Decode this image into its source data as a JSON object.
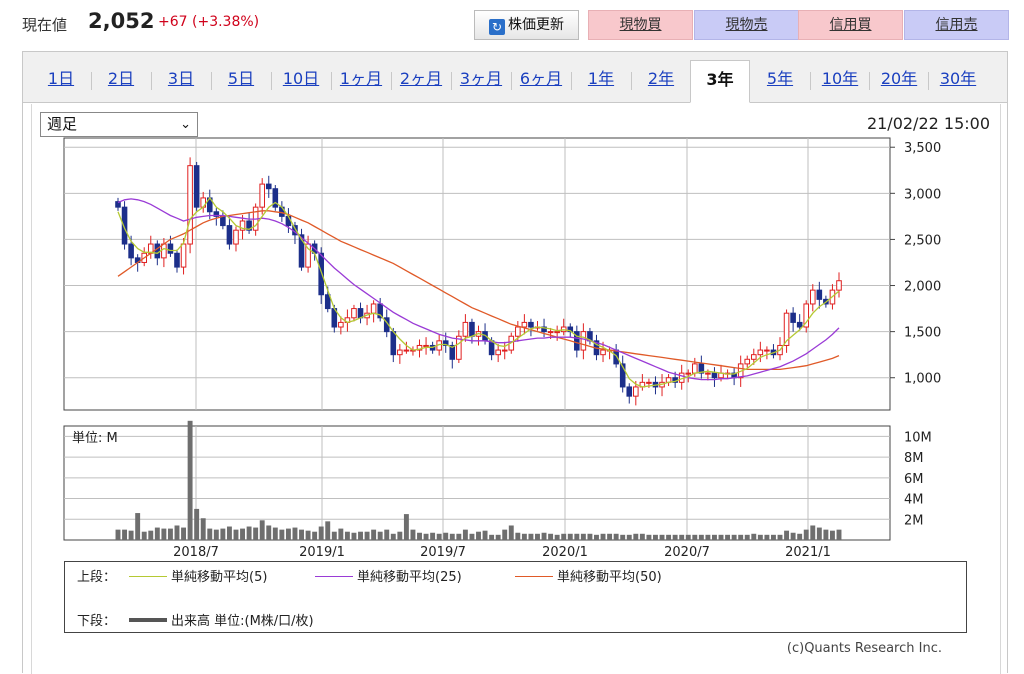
{
  "header": {
    "price_label": "現在値",
    "price_value": "2,052",
    "price_change": "+67 (+3.38%)",
    "refresh_label": "株価更新",
    "buttons": [
      "現物買",
      "現物売",
      "信用買",
      "信用売"
    ]
  },
  "tabs": [
    "1日",
    "2日",
    "3日",
    "5日",
    "10日",
    "1ヶ月",
    "2ヶ月",
    "3ヶ月",
    "6ヶ月",
    "1年",
    "2年",
    "3年",
    "5年",
    "10年",
    "20年",
    "30年"
  ],
  "active_tab": "3年",
  "period_select": "週足",
  "datetime": "21/02/22 15:00",
  "legend": {
    "upper_label": "上段：",
    "lower_label": "下段：",
    "ma5": "単純移動平均(5)",
    "ma25": "単純移動平均(25)",
    "ma50": "単純移動平均(50)",
    "volume": "出来高 単位:(M株/口/枚)"
  },
  "colors": {
    "up": "#e02020",
    "down": "#1c2f8a",
    "ma5": "#b5c933",
    "ma25": "#9a3bd6",
    "ma50": "#e05a28",
    "volume": "#6e6e6e"
  },
  "credit": "(c)Quants Research Inc.",
  "chart_data": {
    "type": "candlestick",
    "title": "",
    "price_axis": {
      "ticks": [
        1000,
        1500,
        2000,
        2500,
        3000,
        3500
      ],
      "tick_labels": [
        "1,000",
        "1,500",
        "2,000",
        "2,500",
        "3,000",
        "3,500"
      ],
      "ylim": [
        650,
        3600
      ]
    },
    "x_tick_labels": [
      "2018/7",
      "2019/1",
      "2019/7",
      "2020/1",
      "2020/7",
      "2021/1"
    ],
    "volume_panel": {
      "label": "単位: M",
      "ticks": [
        2,
        4,
        6,
        8,
        10
      ],
      "tick_labels": [
        "2M",
        "4M",
        "6M",
        "8M",
        "10M"
      ],
      "ylim": [
        0,
        11
      ]
    },
    "close": [
      2850,
      2450,
      2300,
      2250,
      2350,
      2450,
      2300,
      2450,
      2350,
      2200,
      2450,
      3300,
      2850,
      2950,
      2800,
      2750,
      2650,
      2450,
      2600,
      2700,
      2600,
      2850,
      3100,
      3050,
      2850,
      2750,
      2650,
      2550,
      2200,
      2450,
      2350,
      1900,
      1750,
      1550,
      1600,
      1650,
      1750,
      1650,
      1700,
      1800,
      1650,
      1500,
      1250,
      1300,
      1300,
      1300,
      1350,
      1350,
      1300,
      1400,
      1350,
      1200,
      1450,
      1600,
      1450,
      1500,
      1400,
      1250,
      1300,
      1300,
      1450,
      1550,
      1600,
      1550,
      1550,
      1500,
      1500,
      1500,
      1550,
      1500,
      1300,
      1500,
      1400,
      1250,
      1300,
      1300,
      1150,
      900,
      800,
      900,
      950,
      950,
      900,
      950,
      1000,
      950,
      1050,
      1050,
      1150,
      1050,
      1050,
      1000,
      1050,
      1050,
      1000,
      1150,
      1200,
      1250,
      1300,
      1300,
      1250,
      1350,
      1700,
      1600,
      1550,
      1800,
      1950,
      1850,
      1800,
      1950,
      2052
    ],
    "ma5": [
      2800,
      2620,
      2480,
      2400,
      2360,
      2360,
      2350,
      2400,
      2380,
      2380,
      2460,
      2720,
      2800,
      2850,
      2950,
      2850,
      2800,
      2730,
      2650,
      2620,
      2610,
      2650,
      2750,
      2850,
      2900,
      2850,
      2750,
      2620,
      2500,
      2400,
      2350,
      2150,
      1950,
      1750,
      1650,
      1600,
      1620,
      1650,
      1680,
      1700,
      1680,
      1600,
      1500,
      1420,
      1350,
      1300,
      1310,
      1330,
      1330,
      1360,
      1360,
      1330,
      1370,
      1430,
      1450,
      1480,
      1460,
      1400,
      1350,
      1340,
      1380,
      1430,
      1480,
      1530,
      1550,
      1540,
      1530,
      1510,
      1520,
      1510,
      1450,
      1440,
      1410,
      1360,
      1330,
      1290,
      1240,
      1120,
      990,
      930,
      900,
      910,
      920,
      930,
      950,
      960,
      990,
      1010,
      1050,
      1060,
      1070,
      1060,
      1050,
      1040,
      1040,
      1070,
      1100,
      1160,
      1220,
      1250,
      1270,
      1300,
      1400,
      1460,
      1520,
      1600,
      1700,
      1770,
      1820,
      1880,
      1940
    ],
    "ma25": [
      2900,
      2930,
      2940,
      2930,
      2910,
      2880,
      2840,
      2800,
      2760,
      2730,
      2700,
      2720,
      2740,
      2750,
      2760,
      2760,
      2760,
      2750,
      2740,
      2730,
      2720,
      2720,
      2730,
      2720,
      2700,
      2670,
      2630,
      2580,
      2520,
      2460,
      2400,
      2330,
      2260,
      2190,
      2130,
      2070,
      2010,
      1960,
      1910,
      1860,
      1810,
      1760,
      1710,
      1670,
      1630,
      1590,
      1560,
      1530,
      1500,
      1470,
      1450,
      1430,
      1420,
      1410,
      1400,
      1400,
      1400,
      1390,
      1380,
      1380,
      1390,
      1400,
      1410,
      1420,
      1430,
      1430,
      1440,
      1440,
      1440,
      1440,
      1430,
      1420,
      1400,
      1380,
      1360,
      1330,
      1300,
      1270,
      1240,
      1210,
      1180,
      1150,
      1120,
      1090,
      1060,
      1040,
      1020,
      1000,
      990,
      980,
      980,
      980,
      990,
      990,
      1000,
      1010,
      1020,
      1040,
      1060,
      1080,
      1100,
      1120,
      1150,
      1180,
      1220,
      1260,
      1310,
      1360,
      1410,
      1470,
      1540
    ],
    "ma50": [
      2100,
      2150,
      2200,
      2250,
      2300,
      2350,
      2400,
      2450,
      2500,
      2530,
      2560,
      2600,
      2640,
      2680,
      2710,
      2730,
      2750,
      2760,
      2770,
      2780,
      2790,
      2800,
      2810,
      2810,
      2800,
      2790,
      2770,
      2740,
      2710,
      2680,
      2640,
      2600,
      2560,
      2520,
      2480,
      2450,
      2420,
      2390,
      2360,
      2330,
      2300,
      2270,
      2240,
      2200,
      2160,
      2120,
      2080,
      2040,
      2000,
      1960,
      1920,
      1880,
      1840,
      1800,
      1760,
      1730,
      1700,
      1670,
      1640,
      1610,
      1580,
      1560,
      1540,
      1520,
      1500,
      1480,
      1460,
      1440,
      1420,
      1400,
      1380,
      1360,
      1340,
      1320,
      1310,
      1300,
      1290,
      1280,
      1270,
      1260,
      1250,
      1240,
      1230,
      1220,
      1210,
      1200,
      1190,
      1180,
      1170,
      1160,
      1150,
      1140,
      1130,
      1120,
      1110,
      1100,
      1090,
      1090,
      1090,
      1090,
      1090,
      1090,
      1100,
      1110,
      1120,
      1130,
      1150,
      1170,
      1190,
      1210,
      1240
    ],
    "volume": [
      1.0,
      1.0,
      0.9,
      2.6,
      0.8,
      0.9,
      1.2,
      1.1,
      1.1,
      1.4,
      1.2,
      11.5,
      3.0,
      2.1,
      1.1,
      1.0,
      1.1,
      1.3,
      1.0,
      1.1,
      1.3,
      1.2,
      1.9,
      1.4,
      1.2,
      1.0,
      1.1,
      1.2,
      1.0,
      0.9,
      0.8,
      1.3,
      1.8,
      0.8,
      1.1,
      0.8,
      0.7,
      0.8,
      0.8,
      1.0,
      0.8,
      1.0,
      0.6,
      0.8,
      2.5,
      1.0,
      0.7,
      0.6,
      0.7,
      0.6,
      0.7,
      0.6,
      0.6,
      1.0,
      0.6,
      0.8,
      0.9,
      0.5,
      0.5,
      1.0,
      1.4,
      0.7,
      0.6,
      0.6,
      0.6,
      0.7,
      0.6,
      0.5,
      0.6,
      0.6,
      0.6,
      0.6,
      0.6,
      0.5,
      0.6,
      0.6,
      0.6,
      0.5,
      0.5,
      0.6,
      0.6,
      0.5,
      0.5,
      0.5,
      0.5,
      0.5,
      0.5,
      0.5,
      0.5,
      0.5,
      0.5,
      0.5,
      0.5,
      0.5,
      0.5,
      0.5,
      0.5,
      0.6,
      0.5,
      0.5,
      0.5,
      0.5,
      0.9,
      0.7,
      0.6,
      1.0,
      1.4,
      1.2,
      1.0,
      0.9,
      1.0
    ]
  }
}
